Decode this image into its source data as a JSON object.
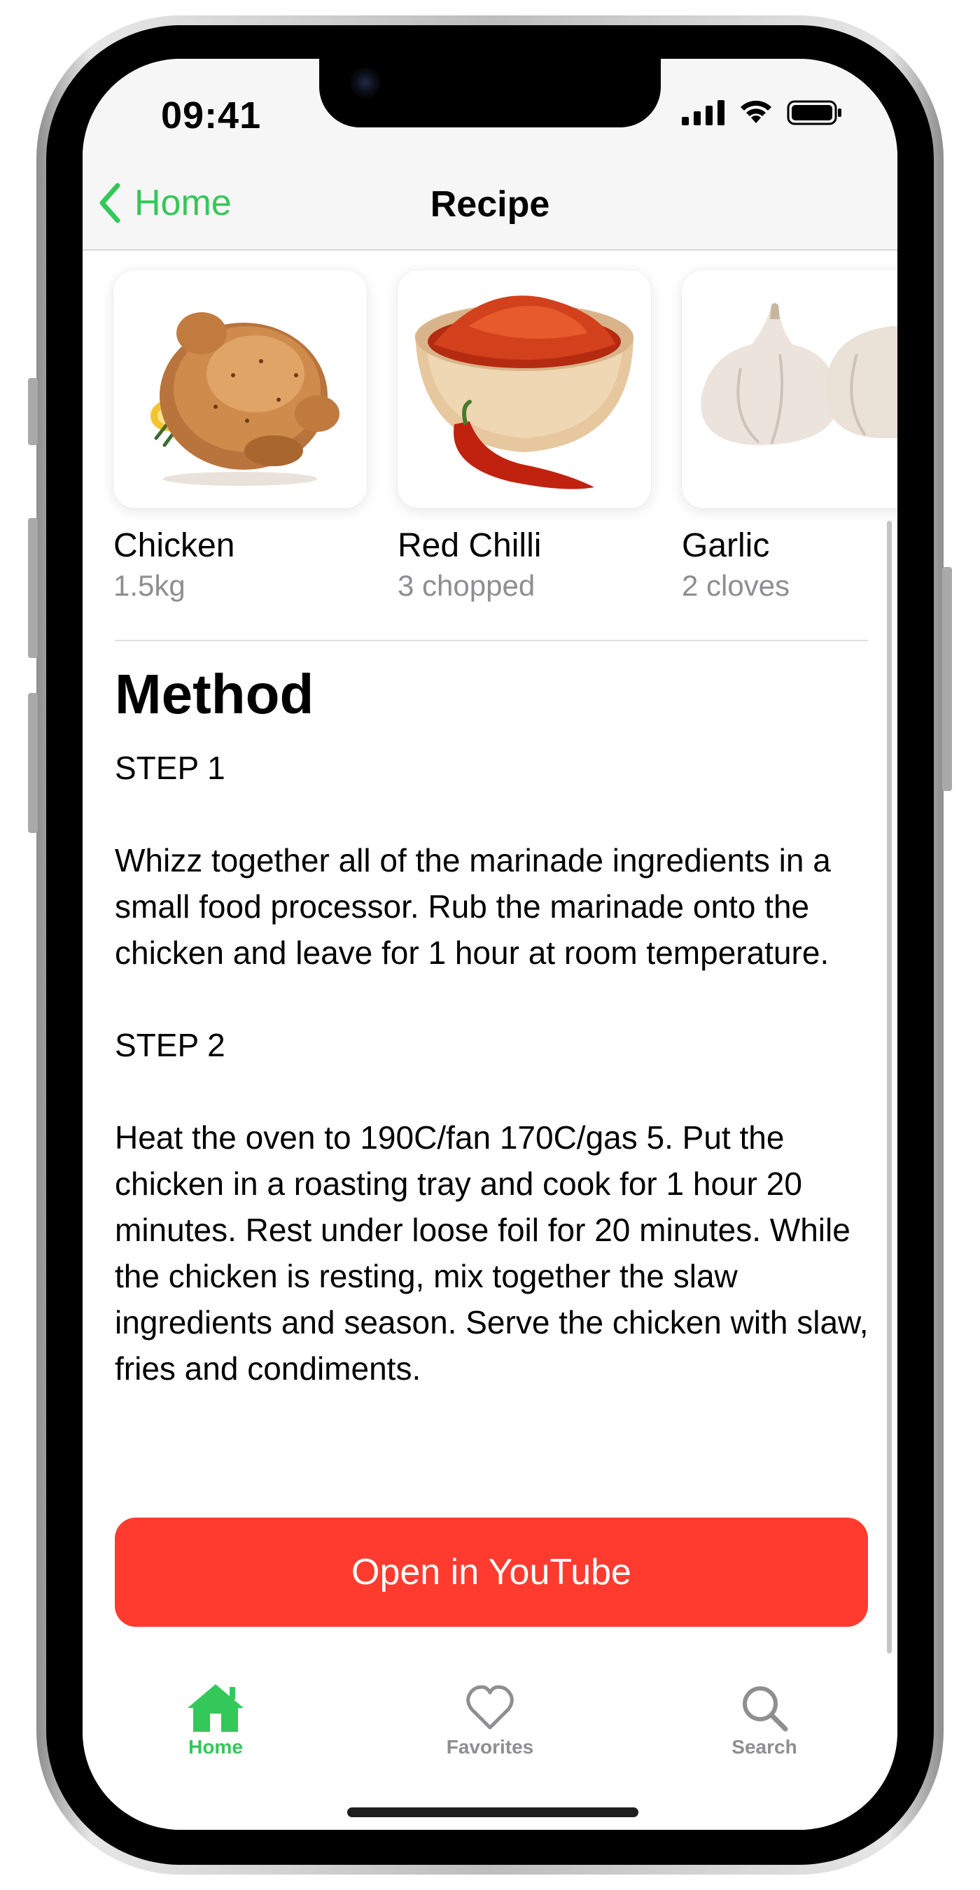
{
  "status_bar": {
    "time": "09:41"
  },
  "nav": {
    "back_label": "Home",
    "title": "Recipe"
  },
  "ingredients": [
    {
      "name": "Chicken",
      "quantity": "1.5kg",
      "image": "roast-chicken-image"
    },
    {
      "name": "Red Chilli",
      "quantity": "3 chopped",
      "image": "chilli-powder-image"
    },
    {
      "name": "Garlic",
      "quantity": "2 cloves",
      "image": "garlic-image"
    }
  ],
  "method": {
    "title": "Method",
    "steps": [
      "STEP 1",
      "Whizz together all of the marinade ingredients in a small food processor. Rub the marinade onto the chicken and leave for 1 hour at room temperature.",
      "STEP 2",
      "Heat the oven to 190C/fan 170C/gas 5. Put the chicken in a roasting tray and cook for 1 hour 20 minutes. Rest under loose foil for 20 minutes. While the chicken is resting, mix together the slaw ingredients and season. Serve the chicken with slaw, fries and condiments."
    ]
  },
  "youtube_button": {
    "label": "Open in YouTube"
  },
  "tabbar": {
    "tabs": [
      {
        "label": "Home",
        "icon": "house-icon",
        "active": true
      },
      {
        "label": "Favorites",
        "icon": "heart-icon",
        "active": false
      },
      {
        "label": "Search",
        "icon": "search-icon",
        "active": false
      }
    ]
  },
  "colors": {
    "accent": "#34c759",
    "button": "#ff3b30",
    "inactive": "#8e8e93"
  }
}
